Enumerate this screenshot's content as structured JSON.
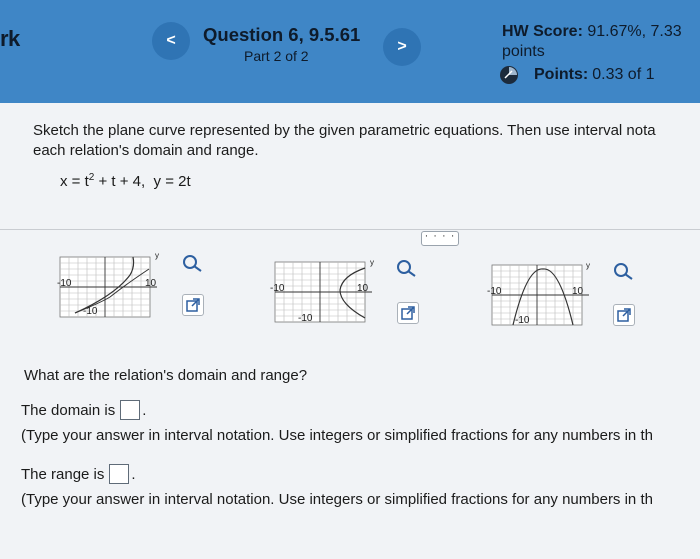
{
  "header": {
    "left_fragment": "rk",
    "prev_label": "<",
    "next_label": ">",
    "question_title": "Question 6, 9.5.61",
    "question_part": "Part 2 of 2",
    "hw_score_label": "HW Score:",
    "hw_score_value": "91.67%, 7.33",
    "hw_score_cont": "points",
    "points_label": "Points:",
    "points_value": "0.33 of 1"
  },
  "problem": {
    "instructions_line1": "Sketch the plane curve represented by the given parametric equations. Then use interval nota",
    "instructions_line2": "each relation's domain and range.",
    "eq_x_prefix": "x = t",
    "eq_x_exp": "2",
    "eq_x_suffix": " + t + 4,",
    "eq_y": "y = 2t",
    "more_label": "· · · ·"
  },
  "graphs": [
    {
      "id": "A",
      "tick_neg": "-10",
      "tick_pos": "10",
      "tick_bottom": "-10",
      "axis_label": "y"
    },
    {
      "id": "B",
      "tick_neg": "-10",
      "tick_pos": "10",
      "tick_bottom": "-10",
      "axis_label": "y"
    },
    {
      "id": "C",
      "tick_neg": "-10",
      "tick_pos": "10",
      "tick_bottom": "-10",
      "axis_label": "y"
    }
  ],
  "questions": {
    "prompt": "What are the relation's domain and range?",
    "domain_label": "The domain is",
    "domain_note": "(Type your answer in interval notation. Use integers or simplified fractions for any numbers in th",
    "range_label": "The range is",
    "range_note": "(Type your answer in interval notation. Use integers or simplified fractions for any numbers in th"
  },
  "colors": {
    "header_bg": "#3f86c6",
    "nav_btn": "#2f74b4",
    "page_bg": "#f1f3f6"
  },
  "icons": [
    "chevron-left-icon",
    "chevron-right-icon",
    "points-icon",
    "zoom-icon",
    "external-link-icon"
  ]
}
